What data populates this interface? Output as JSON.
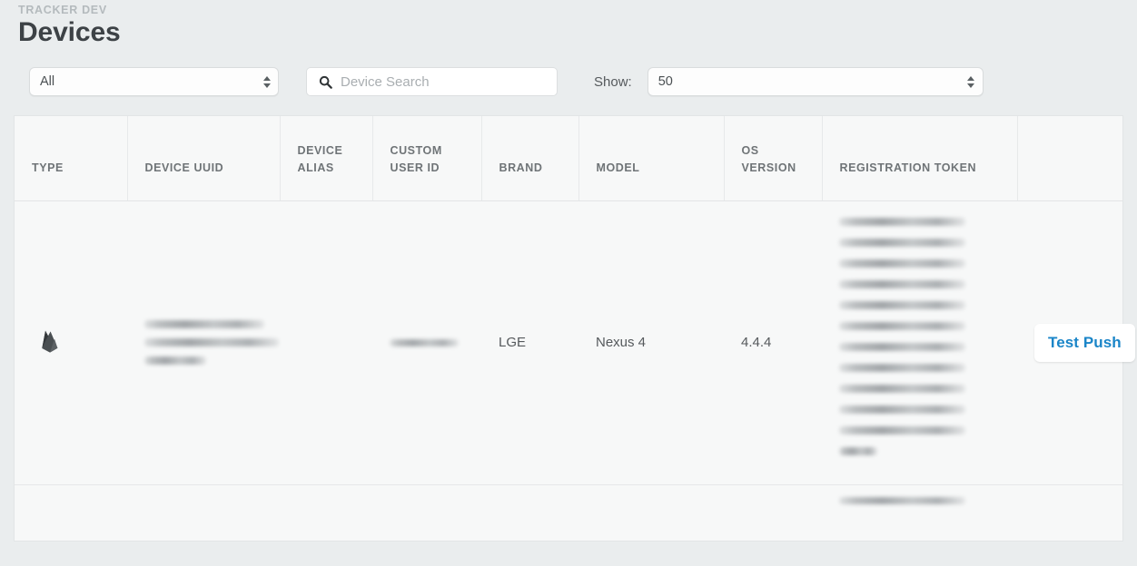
{
  "header": {
    "eyebrow": "TRACKER DEV",
    "title": "Devices"
  },
  "toolbar": {
    "type_filter": {
      "value": "All",
      "icon": "stepper-arrows-icon"
    },
    "search": {
      "value": "",
      "placeholder": "Device Search",
      "icon": "search-icon"
    },
    "show": {
      "label": "Show:",
      "value": "50",
      "icon": "stepper-arrows-icon"
    }
  },
  "table": {
    "columns": [
      {
        "key": "type",
        "label": "TYPE"
      },
      {
        "key": "uuid",
        "label": "DEVICE UUID"
      },
      {
        "key": "alias",
        "label": "DEVICE ALIAS"
      },
      {
        "key": "userid",
        "label": "CUSTOM USER ID"
      },
      {
        "key": "brand",
        "label": "BRAND"
      },
      {
        "key": "model",
        "label": "MODEL"
      },
      {
        "key": "os",
        "label": "OS VERSION"
      },
      {
        "key": "token",
        "label": "REGISTRATION TOKEN"
      },
      {
        "key": "action",
        "label": ""
      }
    ],
    "rows": [
      {
        "type_icon": "firebase-flame-icon",
        "uuid": "",
        "uuid_redacted_lines": 3,
        "alias": "",
        "userid": "",
        "userid_redacted_lines": 1,
        "brand": "LGE",
        "model": "Nexus 4",
        "os_version": "4.4.4",
        "token": "",
        "token_redacted_lines": 12,
        "action_label": "Test Push"
      }
    ]
  },
  "colors": {
    "page_background": "#eaedee",
    "table_background": "#f7f8f8",
    "title_text": "#3d4246",
    "eyebrow_text": "#b4babd",
    "header_text": "#6f7477",
    "body_text": "#55595c",
    "accent_link": "#1a85c8",
    "border": "#e6e8e9"
  }
}
